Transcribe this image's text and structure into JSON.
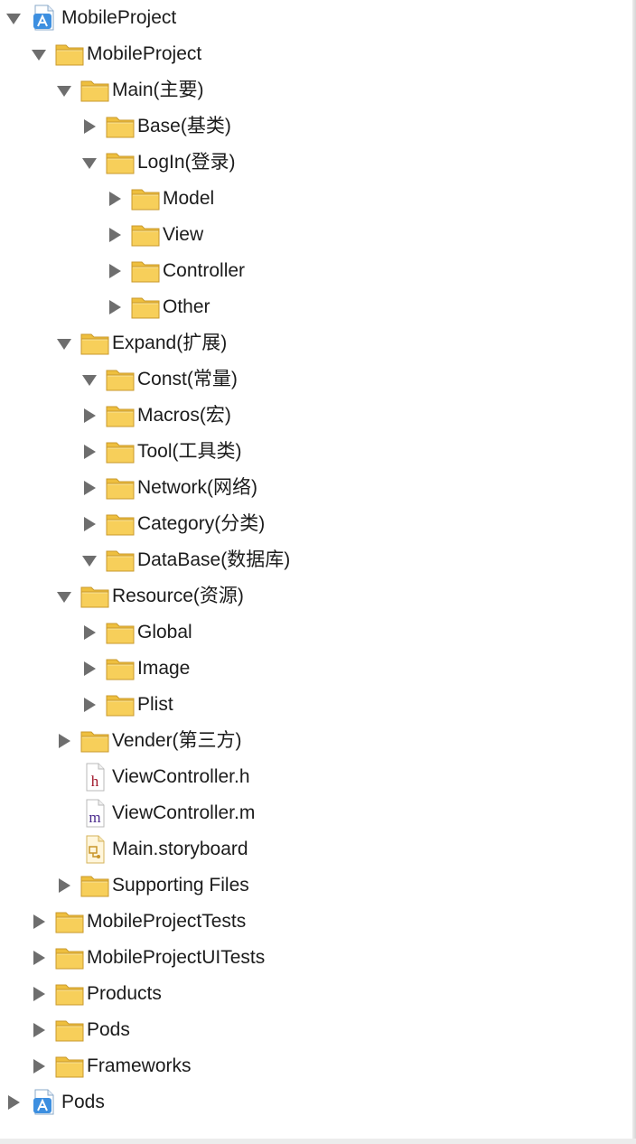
{
  "colors": {
    "folder_body": "#f7cf5a",
    "folder_tab": "#eebf3e",
    "folder_outline": "#c99a2c",
    "project_icon": "#3d8fe0",
    "disclosure": "#6e6e6e",
    "text": "#1c1c1c",
    "header_h": "#a0162a",
    "impl_m": "#4a2a8c"
  },
  "tree": [
    {
      "level": 0,
      "kind": "project",
      "state": "expanded",
      "label": "MobileProject",
      "icon": "xcode-project-icon"
    },
    {
      "level": 1,
      "kind": "folder",
      "state": "expanded",
      "label": "MobileProject",
      "icon": "folder-icon"
    },
    {
      "level": 2,
      "kind": "folder",
      "state": "expanded",
      "label": "Main(主要)",
      "icon": "folder-icon"
    },
    {
      "level": 3,
      "kind": "folder",
      "state": "collapsed",
      "label": "Base(基类)",
      "icon": "folder-icon"
    },
    {
      "level": 3,
      "kind": "folder",
      "state": "expanded",
      "label": "LogIn(登录)",
      "icon": "folder-icon"
    },
    {
      "level": 4,
      "kind": "folder",
      "state": "collapsed",
      "label": "Model",
      "icon": "folder-icon"
    },
    {
      "level": 4,
      "kind": "folder",
      "state": "collapsed",
      "label": "View",
      "icon": "folder-icon"
    },
    {
      "level": 4,
      "kind": "folder",
      "state": "collapsed",
      "label": "Controller",
      "icon": "folder-icon"
    },
    {
      "level": 4,
      "kind": "folder",
      "state": "collapsed",
      "label": "Other",
      "icon": "folder-icon"
    },
    {
      "level": 2,
      "kind": "folder",
      "state": "expanded",
      "label": "Expand(扩展)",
      "icon": "folder-icon"
    },
    {
      "level": 3,
      "kind": "folder",
      "state": "expanded",
      "label": "Const(常量)",
      "icon": "folder-icon"
    },
    {
      "level": 3,
      "kind": "folder",
      "state": "collapsed",
      "label": "Macros(宏)",
      "icon": "folder-icon"
    },
    {
      "level": 3,
      "kind": "folder",
      "state": "collapsed",
      "label": "Tool(工具类)",
      "icon": "folder-icon"
    },
    {
      "level": 3,
      "kind": "folder",
      "state": "collapsed",
      "label": "Network(网络)",
      "icon": "folder-icon"
    },
    {
      "level": 3,
      "kind": "folder",
      "state": "collapsed",
      "label": "Category(分类)",
      "icon": "folder-icon"
    },
    {
      "level": 3,
      "kind": "folder",
      "state": "expanded",
      "label": "DataBase(数据库)",
      "icon": "folder-icon"
    },
    {
      "level": 2,
      "kind": "folder",
      "state": "expanded",
      "label": "Resource(资源)",
      "icon": "folder-icon"
    },
    {
      "level": 3,
      "kind": "folder",
      "state": "collapsed",
      "label": "Global",
      "icon": "folder-icon"
    },
    {
      "level": 3,
      "kind": "folder",
      "state": "collapsed",
      "label": "Image",
      "icon": "folder-icon"
    },
    {
      "level": 3,
      "kind": "folder",
      "state": "collapsed",
      "label": "Plist",
      "icon": "folder-icon"
    },
    {
      "level": 2,
      "kind": "folder",
      "state": "collapsed",
      "label": "Vender(第三方)",
      "icon": "folder-icon"
    },
    {
      "level": 2,
      "kind": "file-h",
      "state": "none",
      "label": "ViewController.h",
      "icon": "header-file-icon",
      "glyph": "h"
    },
    {
      "level": 2,
      "kind": "file-m",
      "state": "none",
      "label": "ViewController.m",
      "icon": "implementation-file-icon",
      "glyph": "m"
    },
    {
      "level": 2,
      "kind": "storyboard",
      "state": "none",
      "label": "Main.storyboard",
      "icon": "storyboard-file-icon"
    },
    {
      "level": 2,
      "kind": "folder",
      "state": "collapsed",
      "label": "Supporting Files",
      "icon": "folder-icon"
    },
    {
      "level": 1,
      "kind": "folder",
      "state": "collapsed",
      "label": "MobileProjectTests",
      "icon": "folder-icon"
    },
    {
      "level": 1,
      "kind": "folder",
      "state": "collapsed",
      "label": "MobileProjectUITests",
      "icon": "folder-icon"
    },
    {
      "level": 1,
      "kind": "folder",
      "state": "collapsed",
      "label": "Products",
      "icon": "folder-icon"
    },
    {
      "level": 1,
      "kind": "folder",
      "state": "collapsed",
      "label": "Pods",
      "icon": "folder-icon"
    },
    {
      "level": 1,
      "kind": "folder",
      "state": "collapsed",
      "label": "Frameworks",
      "icon": "folder-icon"
    },
    {
      "level": 0,
      "kind": "project",
      "state": "collapsed",
      "label": "Pods",
      "icon": "xcode-project-icon"
    }
  ]
}
